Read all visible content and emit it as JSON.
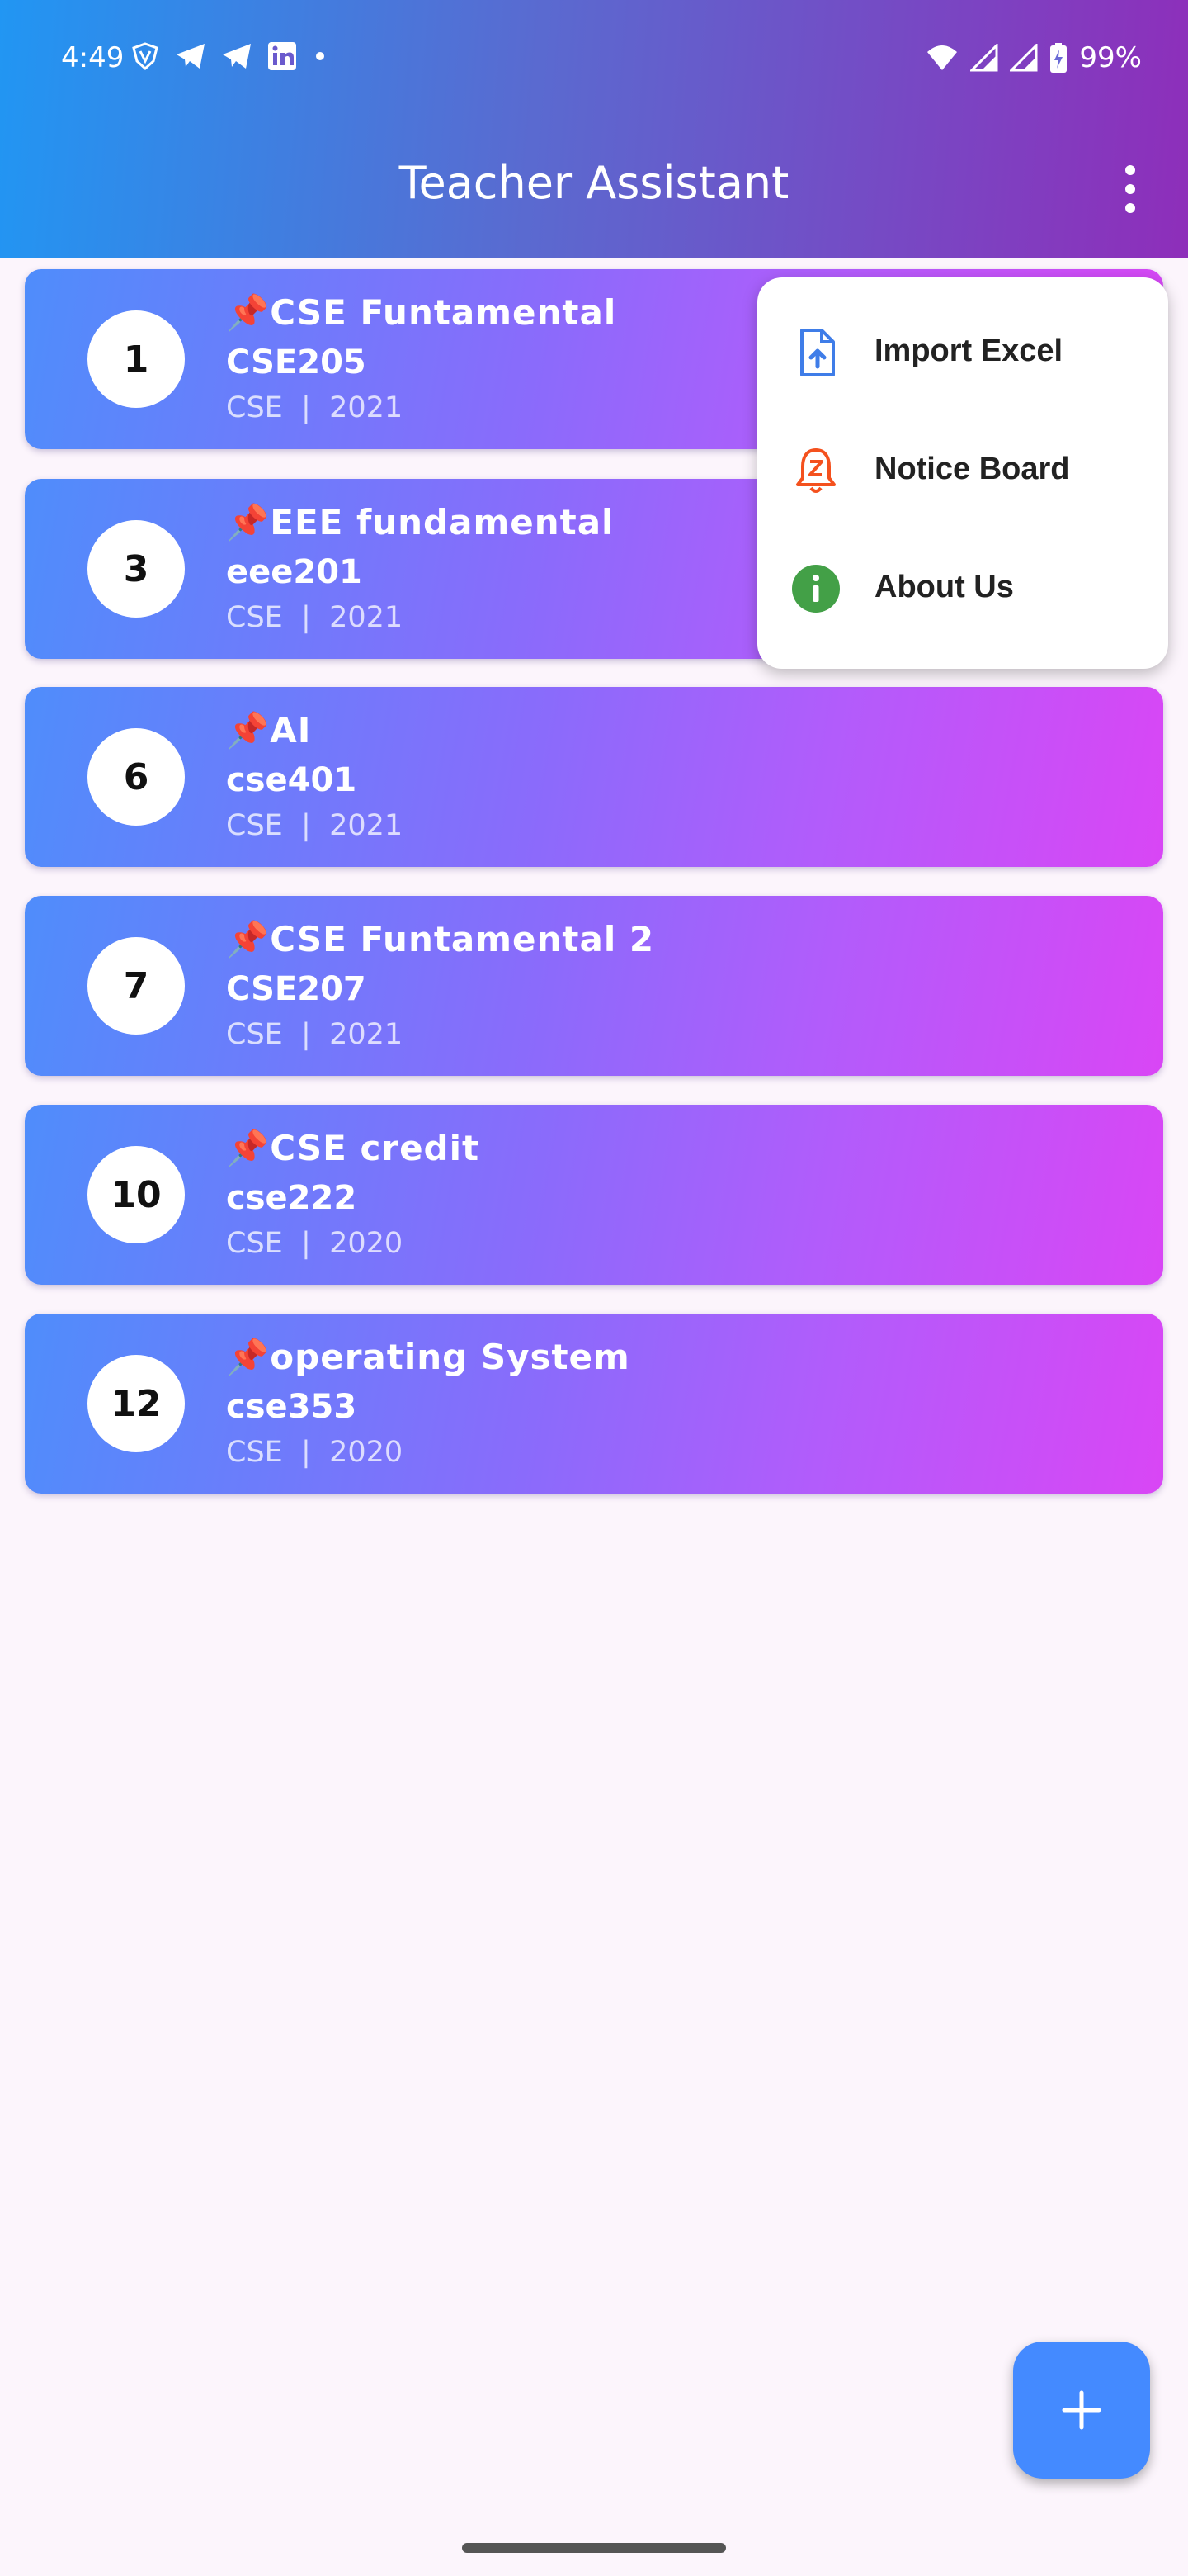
{
  "status_bar": {
    "time": "4:49",
    "battery": "99%"
  },
  "app_bar": {
    "title": "Teacher Assistant"
  },
  "courses": [
    {
      "serial": "1",
      "title": "📌CSE Funtamental",
      "code": "CSE205",
      "meta": "CSE  |  2021"
    },
    {
      "serial": "3",
      "title": "📌EEE fundamental",
      "code": "eee201",
      "meta": "CSE  |  2021"
    },
    {
      "serial": "6",
      "title": "📌AI",
      "code": "cse401",
      "meta": "CSE  |  2021"
    },
    {
      "serial": "7",
      "title": "📌CSE Funtamental 2",
      "code": "CSE207",
      "meta": "CSE  |  2021"
    },
    {
      "serial": "10",
      "title": "📌CSE credit",
      "code": "cse222",
      "meta": "CSE  |  2020"
    },
    {
      "serial": "12",
      "title": "📌operating System",
      "code": "cse353",
      "meta": "CSE  |  2020"
    }
  ],
  "menu": {
    "items": [
      {
        "label": "Import Excel",
        "icon": "file-upload-icon",
        "color": "#3f7de8"
      },
      {
        "label": "Notice Board",
        "icon": "notification-bell-icon",
        "color": "#f4511e"
      },
      {
        "label": "About Us",
        "icon": "info-icon",
        "color": "#43a047"
      }
    ]
  },
  "fab": {
    "icon": "plus-icon",
    "label": "+"
  },
  "colors": {
    "accent": "#448aff",
    "card_start": "#4f8dfb",
    "card_end": "#d946f5"
  }
}
